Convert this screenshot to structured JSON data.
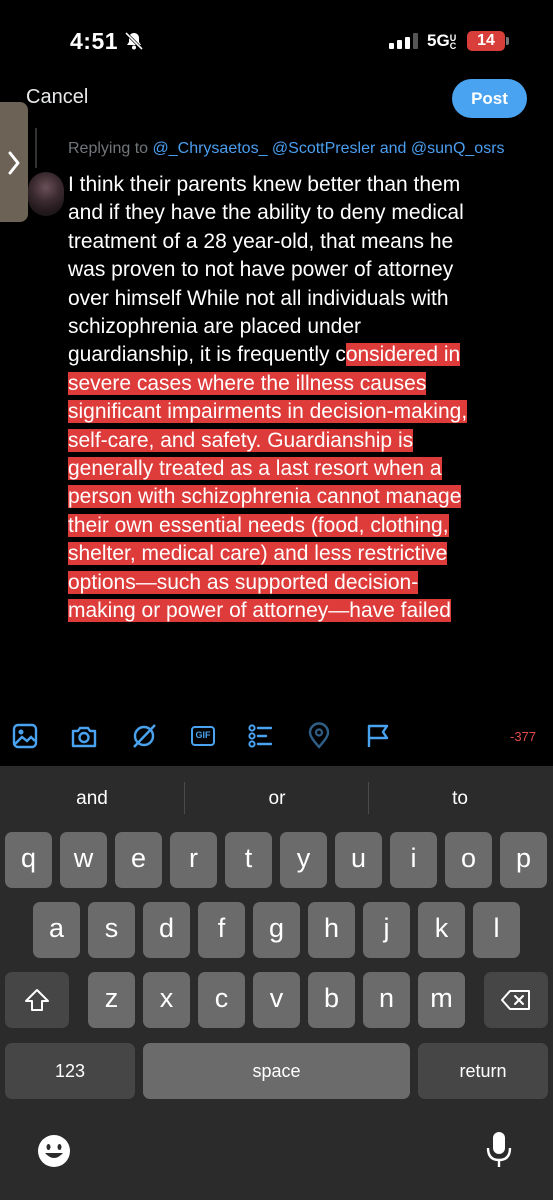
{
  "status_bar": {
    "time": "4:51",
    "network": "5G",
    "network_suffix": "UC",
    "battery": "14"
  },
  "header": {
    "cancel_label": "Cancel",
    "post_label": "Post"
  },
  "reply": {
    "prefix": "Replying to ",
    "mentions": [
      "@_Chrysaetos_",
      "@ScottPresler",
      "@sunQ_osrs"
    ],
    "joiner": " and "
  },
  "compose": {
    "plain_text": "I think their parents knew better than them\nand if they have the ability to deny medical\ntreatment of a 28 year-old, that means he\nwas proven to not have power of attorney\nover himself  While not all individuals with\nschizophrenia are placed under\nguardianship, it is frequently c",
    "highlighted_text": "onsidered in\nsevere cases where the illness causes\nsignificant impairments in decision-making,\nself-care, and safety. Guardianship is\ngenerally treated as a last resort when a\nperson with schizophrenia cannot manage\ntheir own essential needs (food, clothing,\nshelter, medical care) and less restrictive\noptions—such as supported decision-\nmaking or power of attorney—have failed"
  },
  "toolbar": {
    "icons": [
      "image-icon",
      "camera-icon",
      "grok-icon",
      "gif-icon",
      "poll-icon",
      "location-icon",
      "flag-icon"
    ],
    "gif_label": "GIF",
    "char_count": "-377"
  },
  "keyboard": {
    "suggestions": [
      "and",
      "or",
      "to"
    ],
    "row1": [
      "q",
      "w",
      "e",
      "r",
      "t",
      "y",
      "u",
      "i",
      "o",
      "p"
    ],
    "row2": [
      "a",
      "s",
      "d",
      "f",
      "g",
      "h",
      "j",
      "k",
      "l"
    ],
    "row3": [
      "z",
      "x",
      "c",
      "v",
      "b",
      "n",
      "m"
    ],
    "numbers_label": "123",
    "space_label": "space",
    "return_label": "return"
  },
  "colors": {
    "accent": "#4aa3f0",
    "highlight": "#dd3c3a",
    "battery": "#d93f3a",
    "char_count": "#e24a4a"
  }
}
